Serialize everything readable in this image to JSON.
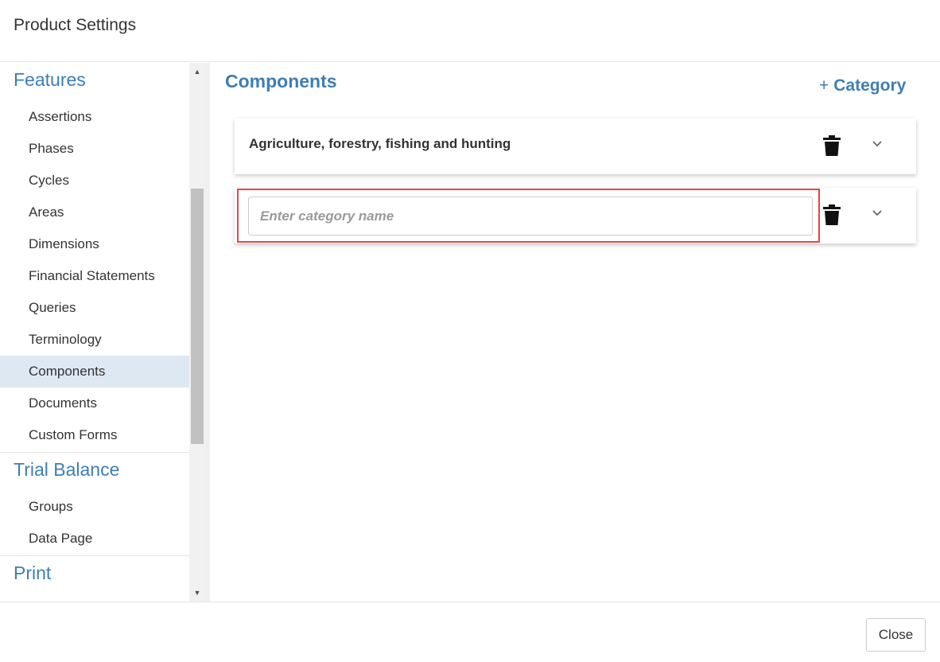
{
  "dialog": {
    "title": "Product Settings"
  },
  "sidebar": {
    "sections": [
      {
        "heading": "Features",
        "items": [
          {
            "label": "Assertions"
          },
          {
            "label": "Phases"
          },
          {
            "label": "Cycles"
          },
          {
            "label": "Areas"
          },
          {
            "label": "Dimensions"
          },
          {
            "label": "Financial Statements"
          },
          {
            "label": "Queries"
          },
          {
            "label": "Terminology"
          },
          {
            "label": "Components",
            "active": true
          },
          {
            "label": "Documents"
          },
          {
            "label": "Custom Forms"
          }
        ]
      },
      {
        "heading": "Trial Balance",
        "items": [
          {
            "label": "Groups"
          },
          {
            "label": "Data Page"
          }
        ]
      },
      {
        "heading": "Print",
        "items": []
      }
    ]
  },
  "main": {
    "title": "Components",
    "add_category": {
      "plus": "+",
      "label": "Category"
    },
    "categories": [
      {
        "label": "Agriculture, forestry, fishing and hunting"
      },
      {
        "value": "",
        "placeholder": "Enter category name",
        "highlighted": true
      }
    ]
  },
  "footer": {
    "close_label": "Close"
  },
  "icons": {
    "delete": "trash-icon",
    "expand": "chevron-down-icon",
    "scroll_up": "arrow-up-icon",
    "scroll_down": "arrow-down-icon"
  },
  "colors": {
    "accent": "#3d7eb5",
    "active_item_bg": "#dde8f2",
    "highlight_border": "#e04848"
  }
}
